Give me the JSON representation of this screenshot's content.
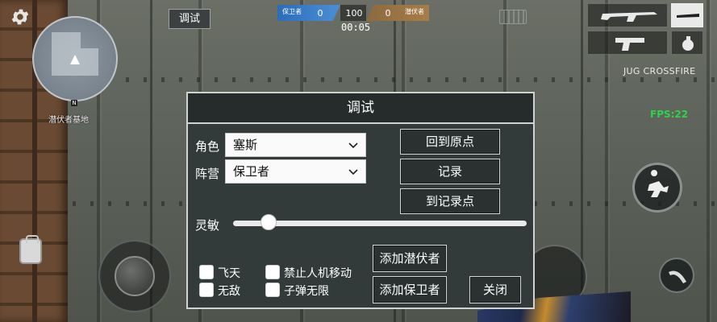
{
  "hud": {
    "debug_button_label": "调试",
    "map_name": "潜伏者基地",
    "minimap_north": "N",
    "score": {
      "left_team": "保卫者",
      "left_score": "0",
      "center": "100",
      "right_score": "0",
      "right_team": "潜伏者"
    },
    "timer": "00:05",
    "game_tag": "JUG CROSSFIRE",
    "fps": "FPS:22"
  },
  "dialog": {
    "title": "调试",
    "role_label": "角色",
    "role_value": "塞斯",
    "camp_label": "阵营",
    "camp_value": "保卫者",
    "back_to_origin": "回到原点",
    "record": "记录",
    "to_record_point": "到记录点",
    "sensitivity_label": "灵敏",
    "sensitivity_value": 0.12,
    "options": [
      {
        "label": "飞天",
        "checked": false
      },
      {
        "label": "禁止人机移动",
        "checked": false
      },
      {
        "label": "无敌",
        "checked": false
      },
      {
        "label": "子弹无限",
        "checked": false
      }
    ],
    "add_lurker": "添加潜伏者",
    "add_defender": "添加保卫者",
    "close": "关闭"
  },
  "colors": {
    "fps": "#2fd24a",
    "team_blue": "#2c6db8",
    "team_brown": "#8c6a3d",
    "dialog_bg": "#323b3a"
  }
}
